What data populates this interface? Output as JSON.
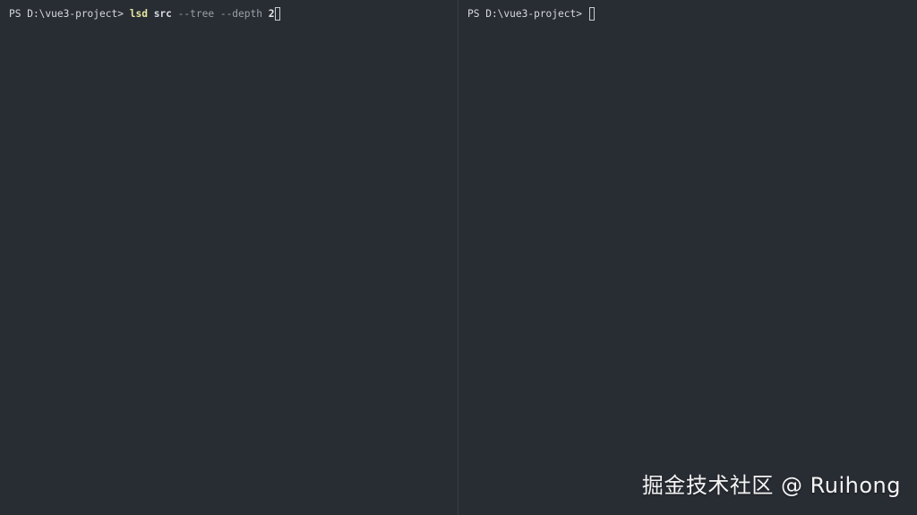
{
  "colors": {
    "background": "#282c33",
    "divider": "#3a3e46",
    "prompt_text": "#d7dae0",
    "command_text": "#e6e6a0",
    "flag_text": "#9aa0aa",
    "watermark_text": "#f4f4f4"
  },
  "left_pane": {
    "prompt": "PS D:\\vue3-project> ",
    "command": "lsd",
    "arg_src": "src",
    "flag_tree": "--tree",
    "flag_depth": "--depth",
    "depth_value": "2"
  },
  "right_pane": {
    "prompt": "PS D:\\vue3-project> "
  },
  "watermark": {
    "text": "掘金技术社区 @ Ruihong"
  }
}
